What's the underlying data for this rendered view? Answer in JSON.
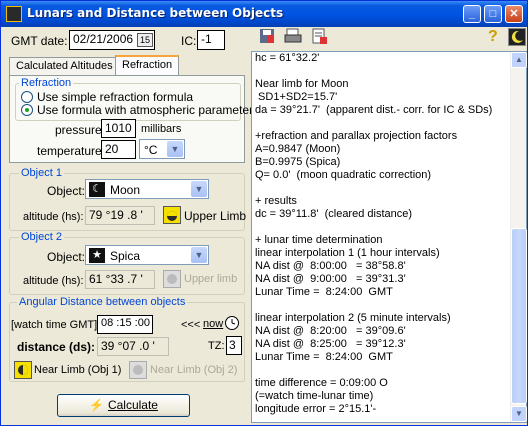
{
  "window": {
    "title": "Lunars and Distance between Objects",
    "min": "_",
    "max": "□",
    "close": "✕"
  },
  "toolbar": {
    "save_icon": "save-icon",
    "print_icon": "print-icon",
    "export_icon": "export-icon",
    "help_glyph": "?"
  },
  "header": {
    "gmt_label": "GMT date:",
    "gmt_value": "02/21/2006",
    "calendar_glyph": "15",
    "ic_label": "IC:",
    "ic_value": "-1"
  },
  "tabs": [
    {
      "label": "Calculated Altitudes"
    },
    {
      "label": "Refraction"
    }
  ],
  "refraction": {
    "title": "Refraction",
    "option1": "Use simple refraction formula",
    "option2": "Use formula with atmospheric parameters",
    "pressure_label": "pressure:",
    "pressure_value": "1010",
    "pressure_unit": "millibars",
    "temperature_label": "temperature:",
    "temperature_value": "20",
    "temperature_unit": "°C"
  },
  "object1": {
    "title": "Object 1",
    "object_label": "Object:",
    "object_value": "Moon",
    "altitude_label": "altitude (hs):",
    "altitude_value": "79 °19 .8 '",
    "limb_label": "Upper Limb"
  },
  "object2": {
    "title": "Object 2",
    "object_label": "Object:",
    "object_value": "Spica",
    "altitude_label": "altitude (hs):",
    "altitude_value": "61 °33 .7 '",
    "limb_label": "Upper limb"
  },
  "angular": {
    "title": "Angular Distance between objects",
    "watch_label": "[watch time GMT]:",
    "watch_value": "08 :15 :00",
    "now_prefix": "<<<",
    "now_label": "now",
    "distance_label": "distance (ds):",
    "distance_value": "39 °07 .0 '",
    "tz_label": "TZ:",
    "tz_value": "3",
    "near1_label": "Near Limb (Obj 1)",
    "near2_label": "Near Limb (Obj 2)"
  },
  "calculate_label": "Calculate",
  "notes": "hc = 61°32.2'\n\nNear limb for Moon\n SD1+SD2=15.7'\nda = 39°21.7'  (apparent dist.- corr. for IC & SDs)\n\n+refraction and parallax projection factors\nA=0.9847 (Moon)\nB=0.9975 (Spica)\nQ= 0.0'  (moon quadratic correction)\n\n+ results\ndc = 39°11.8'  (cleared distance)\n\n+ lunar time determination\nlinear interpolation 1 (1 hour intervals)\nNA dist @  8:00:00   = 38°58.8'\nNA dist @  9:00:00   = 39°31.3'\nLunar Time =  8:24:00  GMT\n\nlinear interpolation 2 (5 minute intervals)\nNA dist @  8:20:00   = 39°09.6'\nNA dist @  8:25:00   = 39°12.3'\nLunar Time =  8:24:00  GMT\n\ntime difference = 0:09:00 O\n(=watch time-lunar time)\nlongitude error = 2°15.1'-"
}
